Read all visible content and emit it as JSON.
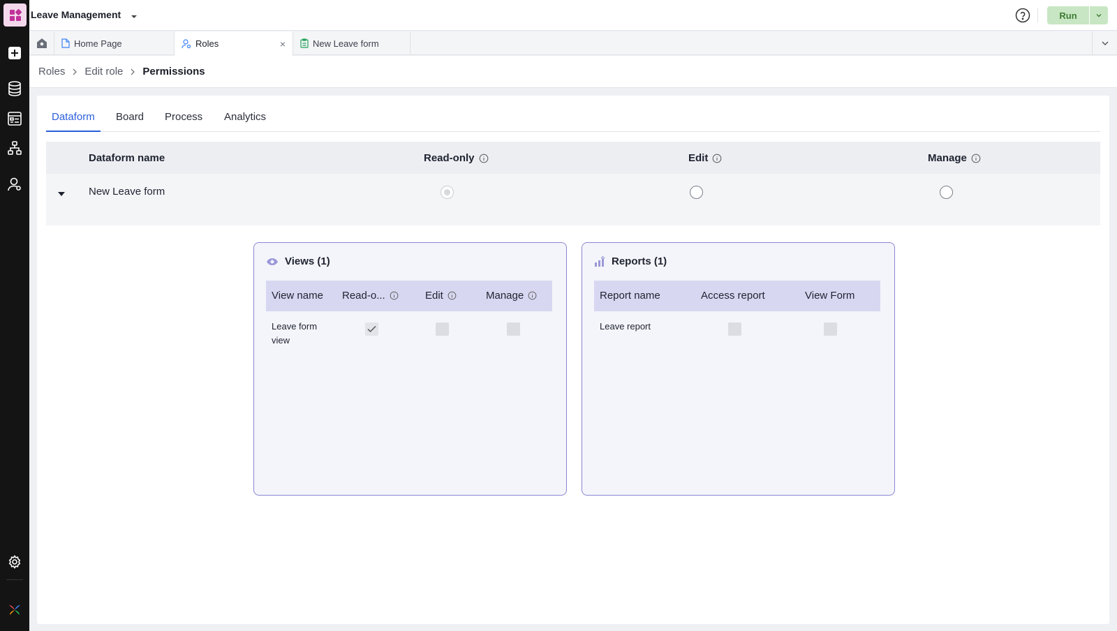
{
  "app": {
    "title": "Leave Management"
  },
  "topbar": {
    "run_label": "Run"
  },
  "tabs": [
    {
      "label": "Home Page"
    },
    {
      "label": "Roles"
    },
    {
      "label": "New Leave form"
    }
  ],
  "breadcrumb": [
    "Roles",
    "Edit role",
    "Permissions"
  ],
  "subtabs": [
    "Dataform",
    "Board",
    "Process",
    "Analytics"
  ],
  "permissions_table": {
    "headers": [
      "Dataform name",
      "Read-only",
      "Edit",
      "Manage"
    ],
    "row": {
      "name": "New Leave form",
      "selected": "Read-only"
    }
  },
  "views_card": {
    "title": "Views (1)",
    "headers": [
      "View name",
      "Read-o...",
      "Edit",
      "Manage"
    ],
    "row": {
      "name_line1": "Leave form",
      "name_line2": "view",
      "read_only": true,
      "edit": false,
      "manage": false
    }
  },
  "reports_card": {
    "title": "Reports (1)",
    "headers": [
      "Report name",
      "Access report",
      "View Form"
    ],
    "row": {
      "name": "Leave report",
      "access_report": false,
      "view_form": false
    }
  },
  "colors": {
    "accent": "#2b5fd9",
    "card_border": "#8a86d4",
    "card_header": "#d8d7f1",
    "run_bg": "#c8e6c3",
    "run_text": "#3f7c35",
    "rail_bg": "#141414"
  }
}
